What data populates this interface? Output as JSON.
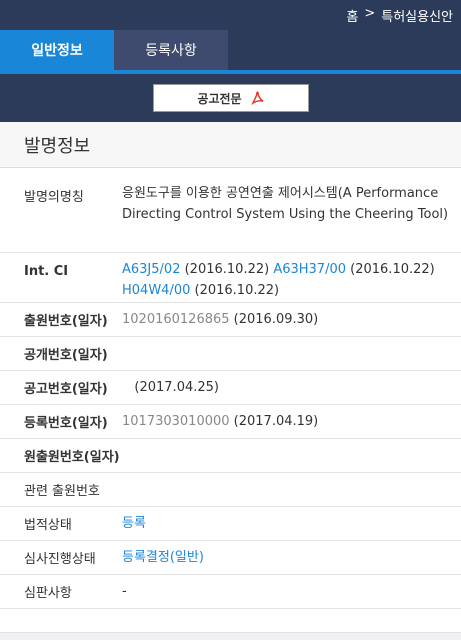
{
  "breadcrumb": {
    "home": "홈",
    "separator": ">",
    "current": "특허실용신안"
  },
  "tabs": [
    {
      "label": "일반정보"
    },
    {
      "label": "등록사항"
    }
  ],
  "notice_button": {
    "label": "공고전문",
    "icon": "pdf-icon"
  },
  "section": {
    "title": "발명정보"
  },
  "fields": {
    "invention_name": {
      "label": "발명의명칭",
      "value": "응원도구를 이용한 공연연출 제어시스템(A Performance Directing Control System Using the Cheering Tool)"
    },
    "int_cl": {
      "label": "Int. CI",
      "items": [
        {
          "code": "A63J5/02",
          "date": "(2016.10.22)"
        },
        {
          "code": "A63H37/00",
          "date": "(2016.10.22)"
        },
        {
          "code": "H04W4/00",
          "date": "(2016.10.22)"
        }
      ]
    },
    "application": {
      "label": "출원번호(일자)",
      "number": "1020160126865",
      "date": "(2016.09.30)"
    },
    "publication": {
      "label": "공개번호(일자)",
      "value": ""
    },
    "announcement": {
      "label": "공고번호(일자)",
      "value": "(2017.04.25)"
    },
    "registration": {
      "label": "등록번호(일자)",
      "number": "1017303010000",
      "date": "(2017.04.19)"
    },
    "original_application": {
      "label": "원출원번호(일자)",
      "value": ""
    },
    "related_application": {
      "label": "관련 출원번호",
      "value": ""
    },
    "legal_status": {
      "label": "법적상태",
      "value": "등록"
    },
    "exam_status": {
      "label": "심사진행상태",
      "value": "등록결정(일반)"
    },
    "trial": {
      "label": "심판사항",
      "value": "-"
    }
  },
  "colors": {
    "navy": "#2d3b5b",
    "accent": "#1a86d8",
    "pdf_red": "#e0301e"
  }
}
